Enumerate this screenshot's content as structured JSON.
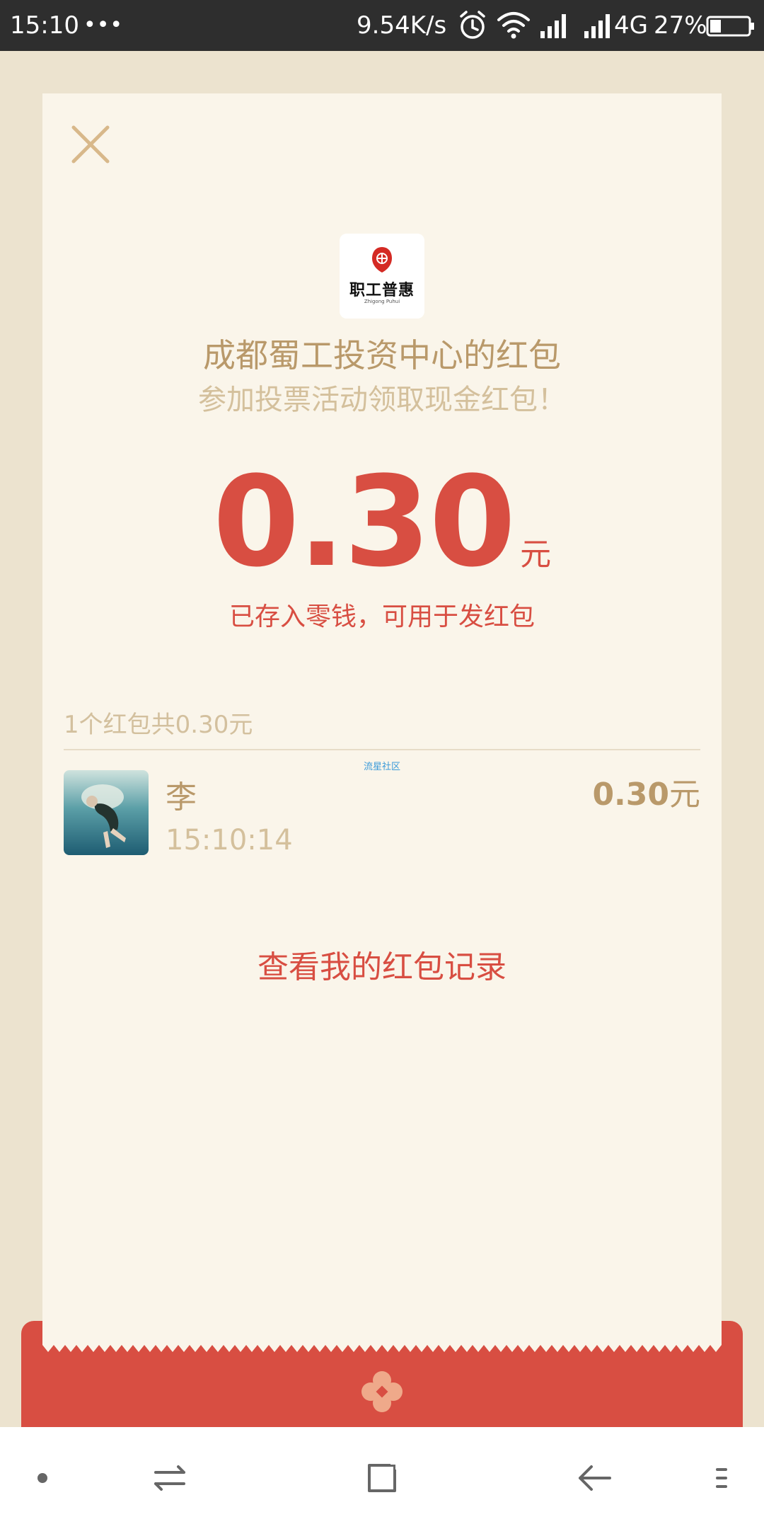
{
  "status_bar": {
    "time": "15:10",
    "dots": "•••",
    "speed": "9.54K/s",
    "network": "4G",
    "battery": "27%"
  },
  "packet": {
    "sender_title": "成都蜀工投资中心的红包",
    "wish": "参加投票活动领取现金红包！",
    "amount": "0.30",
    "unit": "元",
    "stored_note": "已存入零钱，可用于发红包",
    "logo_text": "职工普惠",
    "logo_sub": "Zhigong Puhui"
  },
  "summary": "1个红包共0.30元",
  "watermark": "流星社区",
  "receiver": {
    "name": "李",
    "time": "15:10:14",
    "amount": "0.30",
    "unit": "元"
  },
  "record_link": "查看我的红包记录",
  "icons": {
    "close": "close-icon",
    "alarm": "alarm-icon",
    "wifi": "wifi-icon",
    "signal": "signal-icon",
    "battery": "battery-icon",
    "flower": "flower-icon"
  },
  "colors": {
    "page_bg": "#ece3cf",
    "card_bg": "#faf5ea",
    "red": "#d84e42",
    "gold": "#b9996a",
    "light_gold": "#d4c09c"
  }
}
